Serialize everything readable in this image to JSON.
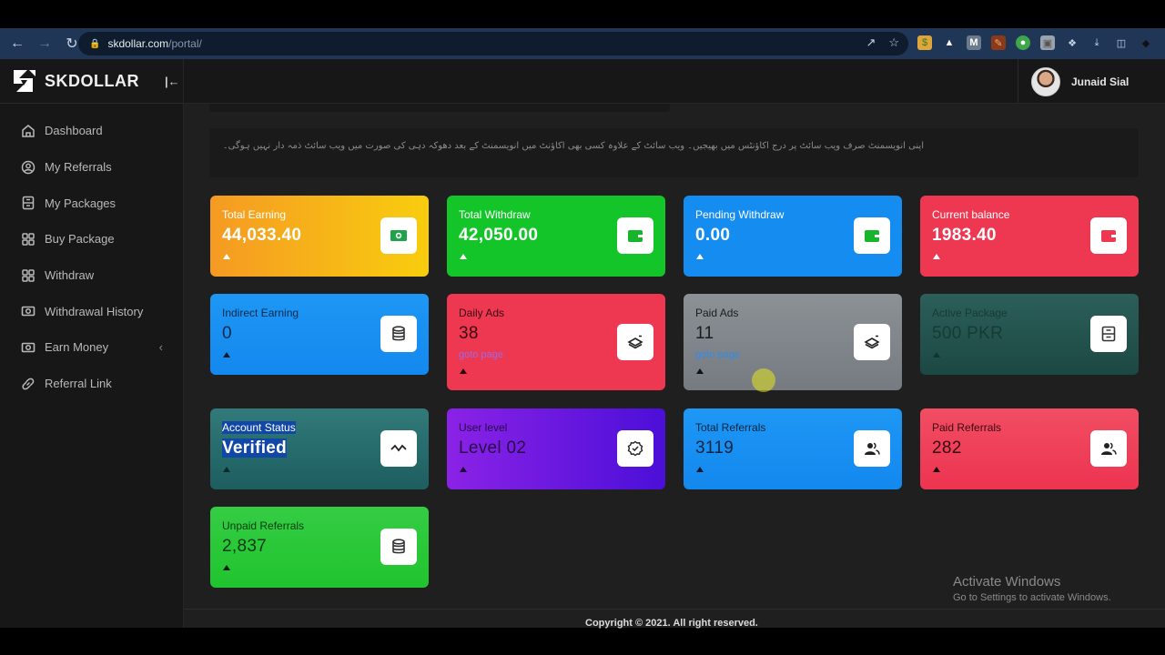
{
  "browser": {
    "url_host": "skdollar.com",
    "url_path": "/portal/",
    "extensions": [
      "coupon-extension-icon",
      "mountain-extension-icon",
      "m-extension-icon",
      "edit-extension-icon",
      "robot-extension-icon",
      "image-extension-icon",
      "puzzle-icon",
      "download-icon",
      "side-panel-icon",
      "metamask-fox-icon",
      "menu-kebab-icon"
    ]
  },
  "brand": {
    "name": "SKDOLLAR"
  },
  "user": {
    "name": "Junaid Sial"
  },
  "sidebar": {
    "items": [
      {
        "label": "Dashboard",
        "icon": "home-icon"
      },
      {
        "label": "My Referrals",
        "icon": "user-circle-icon"
      },
      {
        "label": "My Packages",
        "icon": "cabinet-icon"
      },
      {
        "label": "Buy Package",
        "icon": "grid-icon"
      },
      {
        "label": "Withdraw",
        "icon": "grid-icon"
      },
      {
        "label": "Withdrawal History",
        "icon": "cash-icon"
      },
      {
        "label": "Earn Money",
        "icon": "cash-icon",
        "has_submenu": true
      },
      {
        "label": "Referral Link",
        "icon": "link-icon"
      }
    ]
  },
  "notice": {
    "text": "اپنی انویسمنٹ صرف ویب سائٹ پر درج اکاؤنٹس میں بھیجیں۔ ویب سائٹ کے علاوہ کسی بھی اکاؤنٹ میں انویسمنٹ کے بعد دھوکہ دہی کی صورت میں ویب سائٹ ذمہ دار نہیں ہوگی۔"
  },
  "cards": [
    {
      "label": "Total Earning",
      "value": "44,033.40",
      "icon": "money-icon"
    },
    {
      "label": "Total Withdraw",
      "value": "42,050.00",
      "icon": "wallet-icon"
    },
    {
      "label": "Pending Withdraw",
      "value": "0.00",
      "icon": "wallet-icon"
    },
    {
      "label": "Current balance",
      "value": "1983.40",
      "icon": "wallet-icon"
    },
    {
      "label": "Indirect Earning",
      "value": "0",
      "icon": "database-icon"
    },
    {
      "label": "Daily Ads",
      "value": "38",
      "link": "goto page",
      "icon": "layers-icon"
    },
    {
      "label": "Paid Ads",
      "value": "11",
      "link": "goto page",
      "icon": "layers-icon"
    },
    {
      "label": "Active Package",
      "value": "500 PKR",
      "icon": "cabinet-icon"
    },
    {
      "label": "Account Status",
      "value": "Verified",
      "icon": "activity-icon"
    },
    {
      "label": "User level",
      "value": "Level 02",
      "icon": "badge-check-icon"
    },
    {
      "label": "Total Referrals",
      "value": "3119",
      "icon": "users-icon"
    },
    {
      "label": "Paid Referrals",
      "value": "282",
      "icon": "users-icon"
    },
    {
      "label": "Unpaid Referrals",
      "value": "2,837",
      "icon": "database-icon"
    }
  ],
  "footer": {
    "text": "Copyright © 2021. All right reserved."
  },
  "watermark": {
    "title": "Activate Windows",
    "subtitle": "Go to Settings to activate Windows."
  }
}
